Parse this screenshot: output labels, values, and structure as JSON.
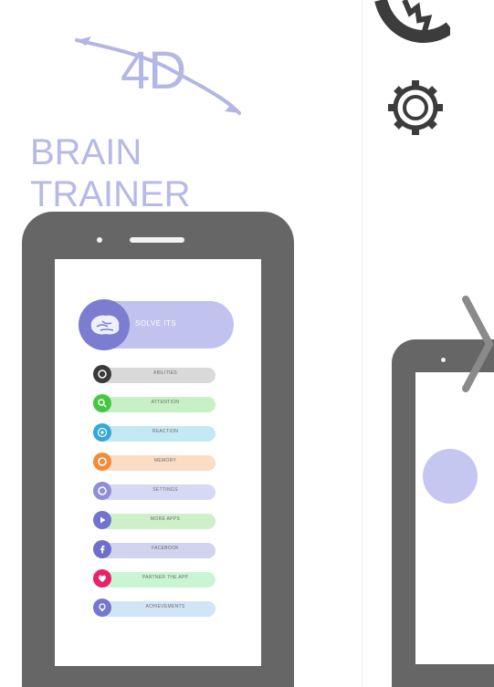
{
  "logo": {
    "mark": "4D",
    "title": "BRAIN TRAINER"
  },
  "hero": {
    "label": "SOLVE ITS",
    "icon": "brain-icon",
    "color": "#c1c2ee",
    "circle_color": "#7b7dd0"
  },
  "menu": [
    {
      "label": "ABILITIES",
      "icon": "circle-icon",
      "icon_color": "#3a3a3a",
      "bar_color": "#d9d9d9"
    },
    {
      "label": "ATTENTION",
      "icon": "search-icon",
      "icon_color": "#46c742",
      "bar_color": "#c8f0c5"
    },
    {
      "label": "REACTION",
      "icon": "target-icon",
      "icon_color": "#35a8d8",
      "bar_color": "#c5e8f5"
    },
    {
      "label": "MEMORY",
      "icon": "ring-icon",
      "icon_color": "#f08c3c",
      "bar_color": "#fbdcc4"
    },
    {
      "label": "SETTINGS",
      "icon": "ring-icon",
      "icon_color": "#8e8fd8",
      "bar_color": "#d7d8f4"
    },
    {
      "label": "MORE APPS",
      "icon": "play-icon",
      "icon_color": "#7173cc",
      "bar_color": "#cdf0c9"
    },
    {
      "label": "FACEBOOK",
      "icon": "facebook-icon",
      "icon_color": "#6e6fca",
      "bar_color": "#d2d3ee"
    },
    {
      "label": "PARTNER THE APP",
      "icon": "heart-icon",
      "icon_color": "#e8236c",
      "bar_color": "#caf5d2"
    },
    {
      "label": "ACHIEVEMENTS",
      "icon": "bulb-icon",
      "icon_color": "#7577cc",
      "bar_color": "#d2e4f8"
    }
  ],
  "next_panel": {
    "icon_top": "gears-icon",
    "icon_next": "chevron-right-icon"
  }
}
